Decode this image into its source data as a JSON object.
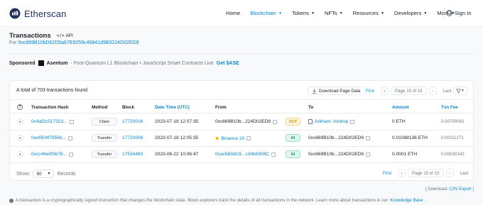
{
  "brand": {
    "name": "Etherscan"
  },
  "nav": {
    "items": [
      {
        "label": "Home",
        "dropdown": false,
        "active": false
      },
      {
        "label": "Blockchain",
        "dropdown": true,
        "active": true
      },
      {
        "label": "Tokens",
        "dropdown": true,
        "active": false
      },
      {
        "label": "NFTs",
        "dropdown": true,
        "active": false
      },
      {
        "label": "Resources",
        "dropdown": true,
        "active": false
      },
      {
        "label": "Developers",
        "dropdown": true,
        "active": false
      },
      {
        "label": "More",
        "dropdown": true,
        "active": false
      }
    ],
    "signin": "Sign In"
  },
  "page": {
    "title": "Transactions",
    "api_label": "API",
    "for_prefix": "For",
    "address": "0xc669B10bD62D5a67E9259c45841d9B3224D02ED9"
  },
  "sponsor": {
    "label": "Sponsored",
    "name": "Asentum",
    "description": "- Post-Quantum L1 Blockchain • JavaScript Smart Contracts Live",
    "cta": "Get $ASE"
  },
  "card": {
    "total_text": "A total of 703 transactions found",
    "download_label": "Download Page Data",
    "pager": {
      "first": "First",
      "prev": "‹",
      "page_text": "Page 15 of 15",
      "next": "›",
      "last": "Last"
    },
    "columns": {
      "info": "?",
      "hash": "Transaction Hash",
      "method": "Method",
      "block": "Block",
      "date": "Date Time (UTC)",
      "from": "From",
      "to": "To",
      "amount": "Amount",
      "fee": "Txn Fee"
    },
    "rows": [
      {
        "hash": "0x4af2c517323...",
        "method": "Claim",
        "block": "17720016",
        "date": "2023-07-18 12:07:35",
        "from": "0xc669B10b...224D02ED9",
        "direction": "OUT",
        "to": "Arkham: Airdrop",
        "amount": "0 ETH",
        "fee": "0.00700091"
      },
      {
        "hash": "0xef504f7856b...",
        "method": "Transfer",
        "block": "17720006",
        "date": "2023-07-18 12:05:35",
        "from": "Binance 20",
        "direction": "IN",
        "to": "0xc669B10b...224D02ED9",
        "amount": "0.01088136 ETH",
        "fee": "0.00111271"
      },
      {
        "hash": "0xcc46e0f3b78...",
        "method": "Transfer",
        "block": "17534460",
        "date": "2023-06-22 10:06:47",
        "from": "0xac683dC6...c34b8308C",
        "direction": "IN",
        "to": "0xc669B10b...224D02ED9",
        "amount": "0.0001 ETH",
        "fee": "0.00030142"
      }
    ],
    "footer": {
      "show_label": "Show:",
      "show_value": "50",
      "records_label": "Records"
    }
  },
  "download_line": {
    "prefix": "[ Download:",
    "link": "CSV Export",
    "suffix": "]"
  },
  "note": {
    "text": "A transaction is a cryptographically signed instruction that changes the blockchain state. Block explorers track the details of all transactions in the network. Learn more about transactions in our",
    "link": "Knowledge Base",
    "end": "."
  },
  "colors": {
    "accent": "#0784c3",
    "brand_dark": "#21325b",
    "out": "#cc9a06",
    "in": "#00a186"
  }
}
